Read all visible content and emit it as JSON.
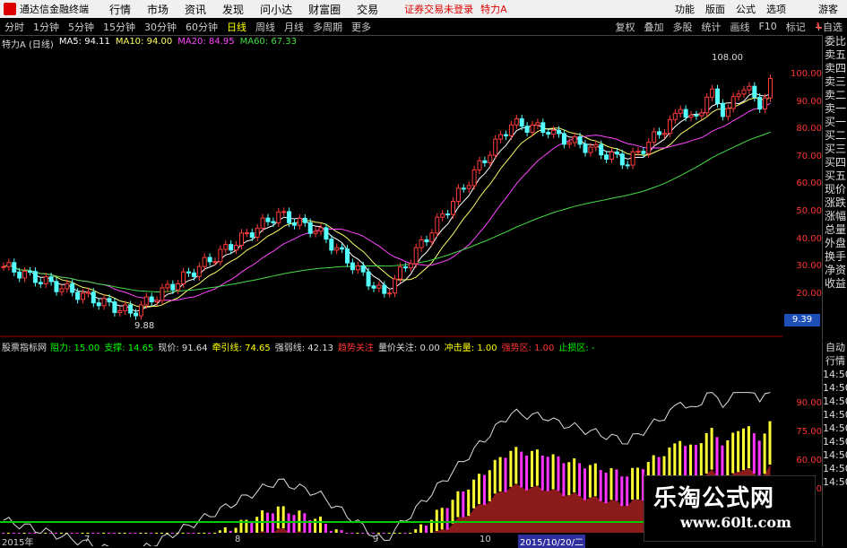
{
  "menubar": {
    "app_title": "通达信金融终端",
    "items": [
      "行情",
      "市场",
      "资讯",
      "发现",
      "问小达",
      "财富圈",
      "交易"
    ],
    "warning": "证券交易未登录",
    "stock": "特力A",
    "right_items": [
      "功能",
      "版面",
      "公式",
      "选项"
    ],
    "guest": "游客"
  },
  "toolbar": {
    "periods": [
      "分时",
      "1分钟",
      "5分钟",
      "15分钟",
      "30分钟",
      "60分钟",
      "日线",
      "周线",
      "月线",
      "多周期",
      "更多"
    ],
    "active": "日线",
    "right_items": [
      "复权",
      "叠加",
      "多股",
      "统计",
      "画线",
      "F10",
      "标记",
      "+自选"
    ]
  },
  "main_legend": {
    "name": "特力A (日线)",
    "ma5": "MA5: 94.11",
    "ma10": "MA10: 94.00",
    "ma20": "MA20: 84.95",
    "ma60": "MA60: 67.33"
  },
  "price_axis": [
    "100.00",
    "90.00",
    "80.00",
    "70.00",
    "60.00",
    "50.00",
    "40.00",
    "30.00",
    "20.00"
  ],
  "price_axis_top": "L",
  "price_labels": {
    "high": "108.00",
    "low": "9.88",
    "current_box": "9.39"
  },
  "indicator_legend": {
    "name": "股票指标网",
    "items": [
      {
        "label": "阻力: 15.00",
        "color": "#0f0"
      },
      {
        "label": "支撑: 14.65",
        "color": "#0f0"
      },
      {
        "label": "现价: 91.64",
        "color": "#ddd"
      },
      {
        "label": "牵引线: 74.65",
        "color": "#ff0"
      },
      {
        "label": "强弱线: 42.13",
        "color": "#ddd"
      },
      {
        "label": "趋势关注",
        "color": "#f33"
      },
      {
        "label": "量价关注: 0.00",
        "color": "#ddd"
      },
      {
        "label": "冲击量: 1.00",
        "color": "#ff0"
      },
      {
        "label": "强势区: 1.00",
        "color": "#f33"
      },
      {
        "label": "止损区: -",
        "color": "#0f0"
      }
    ]
  },
  "indicator_axis": [
    "90.00",
    "75.00",
    "60.00",
    "45.00"
  ],
  "right_panel": [
    "委比",
    "卖五",
    "卖四",
    "卖三",
    "卖二",
    "卖一",
    "买一",
    "买二",
    "买三",
    "买四",
    "买五",
    "现价",
    "涨跌",
    "涨幅",
    "总量",
    "外盘",
    "换手",
    "净资",
    "收益"
  ],
  "right_panel2": [
    "自动",
    "行情",
    "14:50",
    "14:50",
    "14:50",
    "14:50",
    "14:50",
    "14:50",
    "14:50",
    "14:50",
    "14:50"
  ],
  "x_axis": [
    "2015年",
    "7",
    "8",
    "9",
    "10",
    "11"
  ],
  "x_selected": "2015/10/20/二",
  "watermark": {
    "title": "乐淘公式网",
    "url": "www.60lt.com"
  },
  "colors": {
    "up": "#ff3b3b",
    "down": "#54ffff",
    "ma5": "#ffffff",
    "ma10": "#ffff66",
    "ma20": "#ff44ff",
    "ma60": "#44dd44"
  }
}
